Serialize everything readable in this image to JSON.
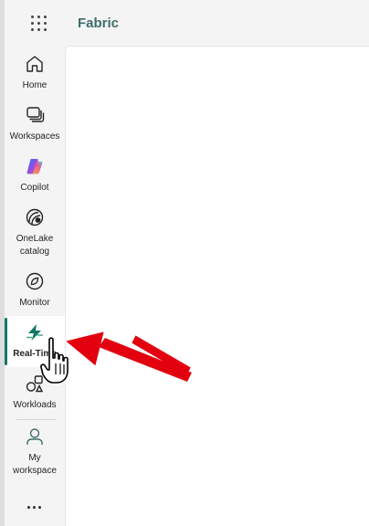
{
  "app": {
    "title": "Fabric"
  },
  "nav": {
    "items": [
      {
        "id": "home",
        "label": "Home",
        "icon": "home-icon"
      },
      {
        "id": "workspaces",
        "label": "Workspaces",
        "icon": "workspaces-icon"
      },
      {
        "id": "copilot",
        "label": "Copilot",
        "icon": "copilot-icon"
      },
      {
        "id": "onelake",
        "label": "OneLake catalog",
        "icon": "onelake-catalog-icon"
      },
      {
        "id": "monitor",
        "label": "Monitor",
        "icon": "monitor-icon"
      },
      {
        "id": "realtime",
        "label": "Real-Time",
        "icon": "real-time-icon",
        "active": true
      },
      {
        "id": "workloads",
        "label": "Workloads",
        "icon": "workloads-icon"
      },
      {
        "id": "myworkspace",
        "label": "My workspace",
        "icon": "my-workspace-icon"
      }
    ],
    "more_label": "..."
  },
  "colors": {
    "brand": "#3d6e6a",
    "active_indicator": "#117865",
    "annotation_arrow": "#e3000f"
  }
}
